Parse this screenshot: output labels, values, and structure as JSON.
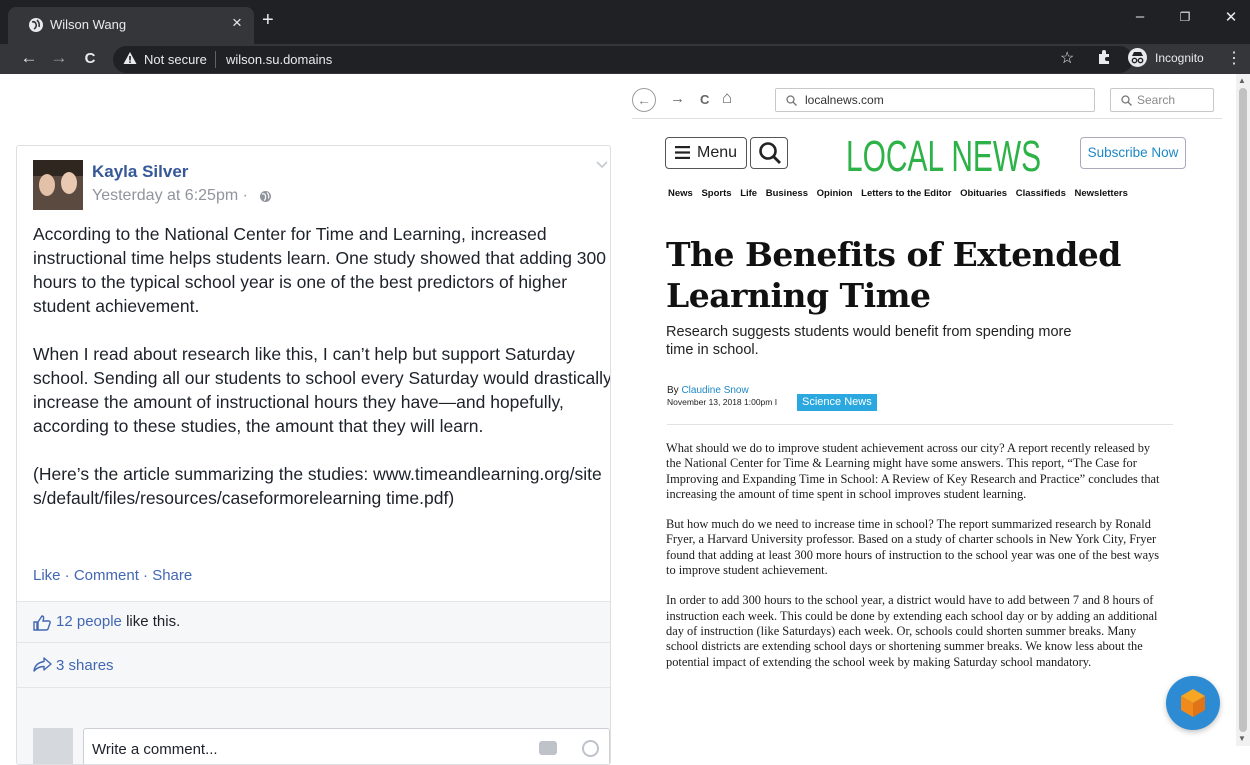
{
  "browser": {
    "tab_title": "Wilson Wang",
    "tab_close": "×",
    "new_tab": "+",
    "secure_label": "Not secure",
    "url": "wilson.su.domains",
    "incognito_label": "Incognito",
    "window_controls": {
      "minimize": "–",
      "restore": "❐",
      "close": "✕"
    },
    "nav": {
      "back": "←",
      "forward": "→",
      "reload": "C",
      "menu": "⋮",
      "star": "☆"
    }
  },
  "post": {
    "author": "Kayla Silver",
    "timestamp": "Yesterday at 6:25pm ·",
    "paragraphs": [
      "According to the National Center for Time and Learning, increased instructional time helps students learn. One study showed that adding 300 hours to the typical school year is one of the best predictors of higher student achievement.",
      "When I read about research like this, I can’t help but support Saturday school. Sending all our students to school every Saturday would drastically increase the amount of instructional hours they have—and hopefully, according to these studies, the amount that they will learn.",
      "(Here’s the article summarizing the studies: www.timeandlearning.org/sites/default/files/resources/caseformorelearning time.pdf)"
    ],
    "actions": "Like · Comment · Share",
    "likes_link": "12 people",
    "likes_suffix": " like this.",
    "shares": "3 shares",
    "comment_placeholder": "Write a comment..."
  },
  "article": {
    "address": "localnews.com",
    "search_placeholder": "Search",
    "nav_back": "←",
    "nav_forward": "→",
    "nav_reload": "C",
    "nav_home": "⌂",
    "menu_label": "Menu",
    "logo": "LOCAL NEWS",
    "subscribe": "Subscribe Now",
    "sections": [
      "News",
      "Sports",
      "Life",
      "Business",
      "Opinion",
      "Letters to the Editor",
      "Obituaries",
      "Classifieds",
      "Newsletters"
    ],
    "headline": "The Benefits of Extended Learning Time",
    "subhead": "Research suggests students would benefit from spending more time in school.",
    "byline_prefix": "By ",
    "byline_author": "Claudine Snow",
    "dateline": "November 13, 2018 1:00pm  I",
    "category": "Science News",
    "body": [
      "What should we do to improve student achievement across our city? A report recently released by the National Center for Time & Learning might have some answers. This report, “The Case for Improving and Expanding Time in School: A Review of Key Research and Practice” concludes that increasing the amount of time spent in school improves student learning.",
      "But how much do we need to increase time in school? The report summarized research by Ronald Fryer, a Harvard University professor. Based on a study of charter schools in New York City, Fryer found that adding at least 300 more hours of instruction to the school year was one of the best ways to improve student achievement.",
      "In order to add 300 hours to the school year, a district would have to add between 7 and 8 hours of instruction each week. This could be done by extending each school day or by adding an additional day of instruction (like Saturdays) each week. Or, schools could shorten summer breaks. Many school districts are extending school days or shortening summer breaks. We know less about the potential impact of extending the school week by making Saturday school mandatory."
    ]
  },
  "colors": {
    "chrome_dark": "#202124",
    "chrome_toolbar": "#35363a",
    "fb_link": "#4267b2",
    "fb_author": "#365899",
    "logo_green": "#2cb247",
    "category_blue": "#2aa8df",
    "fab_blue": "#2d8bd3"
  }
}
